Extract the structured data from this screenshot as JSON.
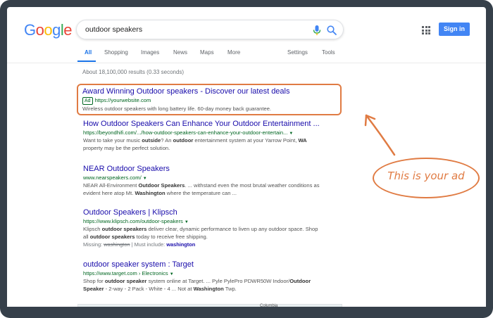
{
  "logo": {
    "letters": [
      "G",
      "o",
      "o",
      "g",
      "l",
      "e"
    ],
    "colors": [
      "#4285f4",
      "#ea4335",
      "#fbbc05",
      "#4285f4",
      "#34a853",
      "#ea4335"
    ]
  },
  "search": {
    "query": "outdoor speakers",
    "mic_icon": "microphone-icon",
    "search_icon": "magnifier-icon"
  },
  "header": {
    "apps_icon": "apps-grid-icon",
    "signin_label": "Sign in"
  },
  "tabs": [
    {
      "label": "All",
      "active": true
    },
    {
      "label": "Shopping"
    },
    {
      "label": "Images"
    },
    {
      "label": "News"
    },
    {
      "label": "Maps"
    },
    {
      "label": "More"
    },
    {
      "label": "Settings"
    },
    {
      "label": "Tools"
    }
  ],
  "stats": "About 18,100,000 results (0.33 seconds)",
  "ad": {
    "title": "Award Winning Outdoor speakers - Discover our latest deals",
    "badge": "Ad",
    "url": "https://yourwebsite.com",
    "snippet": "Wireless outdoor speakers with long battery life. 60-day money back guarantee."
  },
  "results": [
    {
      "title": "How Outdoor Speakers Can Enhance Your Outdoor Entertainment ...",
      "url": "https://beyondhifi.com/.../how-outdoor-speakers-can-enhance-your-outdoor-entertain...",
      "snippet_html": "Want to take your music <b>outside</b>? An <b>outdoor</b> entertainment system at your Yarrow Point, <b>WA</b> property may be the perfect solution."
    },
    {
      "title": "NEAR Outdoor Speakers",
      "url": "www.nearspeakers.com/",
      "snippet_html": "NEAR All-Environment <b>Outdoor Speakers</b>. ... withstand even the most brutal weather conditions as evident here atop Mt. <b>Washington</b> where the temperature can ..."
    },
    {
      "title": "Outdoor Speakers | Klipsch",
      "url": "https://www.klipsch.com/outdoor-speakers",
      "snippet_html": "Klipsch <b>outdoor speakers</b> deliver clear, dynamic performance to liven up any outdoor space. Shop all <b>outdoor speakers</b> today to receive free shipping.",
      "missing_prefix": "Missing:",
      "missing_word": "washington",
      "must_include_prefix": "| Must include:",
      "must_include_word": "washington"
    },
    {
      "title": "outdoor speaker system : Target",
      "url": "https://www.target.com › Electronics",
      "snippet_html": "Shop for <b>outdoor speaker</b> system online at Target. ... Pyle PylePro PDWR50W Indoor/<b>Outdoor Speaker</b> - 2-way - 2 Pack - White - 4 ... Not at <b>Washington</b> Twp."
    }
  ],
  "map_label": "Columbia",
  "annotation": {
    "text": "This is your ad",
    "color": "#e07b43"
  }
}
